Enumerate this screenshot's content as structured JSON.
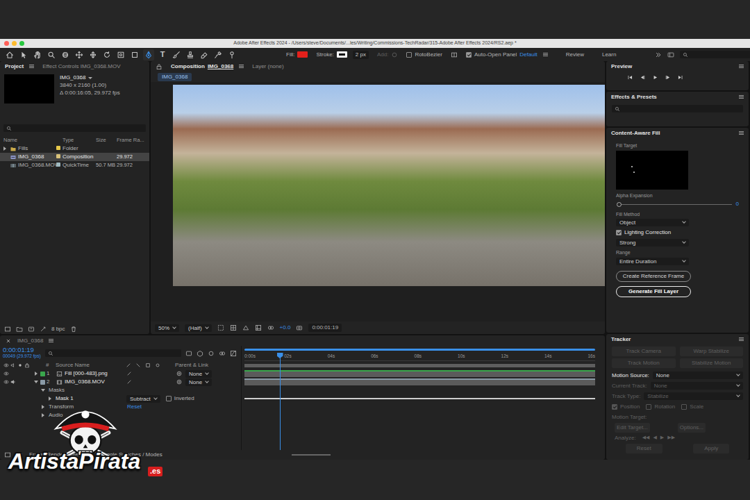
{
  "window": {
    "title": "Adobe After Effects 2024 - /Users/steve/Documents/...les/Writing/Commissions-TechRadar/315-Adobe After Effects 2024/RS2.aep *"
  },
  "toolbar": {
    "tools": [
      {
        "kind": "home",
        "selected": false
      },
      {
        "kind": "select",
        "selected": false
      },
      {
        "kind": "hand",
        "selected": false
      },
      {
        "kind": "zoom",
        "selected": false
      },
      {
        "kind": "orbit",
        "selected": false
      },
      {
        "kind": "pan",
        "selected": false
      },
      {
        "kind": "dolly",
        "selected": false
      },
      {
        "kind": "rotate",
        "selected": false
      },
      {
        "kind": "anchor",
        "selected": false
      },
      {
        "kind": "shape",
        "selected": false
      },
      {
        "kind": "pen",
        "selected": true
      },
      {
        "kind": "type",
        "glyph": "T",
        "selected": false
      },
      {
        "kind": "brush",
        "selected": false
      },
      {
        "kind": "stamp",
        "selected": false
      },
      {
        "kind": "eraser",
        "selected": false
      },
      {
        "kind": "roto",
        "selected": false
      },
      {
        "kind": "puppet",
        "selected": false
      }
    ],
    "fill": {
      "label": "Fill:",
      "color": "#e3201b"
    },
    "stroke": {
      "label": "Stroke:",
      "color": "#ffffff"
    },
    "stroke_width": "2 px",
    "add": {
      "label": "Add:",
      "disabled": true
    },
    "rotobezier": {
      "label": "RotoBezier",
      "checked": false
    },
    "auto_open": {
      "label": "Auto-Open Panel",
      "checked": true
    },
    "workspaces": [
      {
        "label": "Default",
        "selected": true
      },
      {
        "label": "Review",
        "selected": false
      },
      {
        "label": "Learn",
        "selected": false
      }
    ]
  },
  "project": {
    "tabs": [
      {
        "label": "Project",
        "selected": true
      },
      {
        "label": "Effect Controls IMG_0368.MOV",
        "selected": false
      }
    ],
    "item": {
      "name": "IMG_0368",
      "size": "3840 x 2160 (1.00)",
      "duration": "Δ 0:00:16:05, 29.972 fps"
    },
    "columns": [
      "Name",
      "Type",
      "Size",
      "Frame Ra..."
    ],
    "rows": [
      {
        "name": "Fills",
        "type": "Folder",
        "kind": "folder",
        "color": "#e6c84a",
        "selected": false
      },
      {
        "name": "IMG_0368",
        "type": "Composition",
        "fps": "29.972",
        "kind": "composition",
        "color": "#d9c27a",
        "selected": true
      },
      {
        "name": "IMG_0368.MOV",
        "type": "QuickTime",
        "size": "50.7 MB",
        "fps": "29.972",
        "kind": "footage",
        "color": "#9fb9c0",
        "selected": false
      }
    ],
    "bpc": "8 bpc"
  },
  "composition": {
    "tabs": [
      {
        "label": "Composition",
        "comp": "IMG_0368",
        "selected": true
      },
      {
        "label": "Layer (none)",
        "selected": false
      }
    ],
    "breadcrumb": "IMG_0368",
    "zoom": "50%",
    "resolution": "(Half)",
    "exposure": "+0.0",
    "time": "0:00:01:19"
  },
  "preview": {
    "title": "Preview"
  },
  "effects": {
    "title": "Effects & Presets"
  },
  "content_aware_fill": {
    "title": "Content-Aware Fill",
    "fill_target": "Fill Target",
    "alpha_expansion": {
      "label": "Alpha Expansion",
      "value": "0",
      "level": 0
    },
    "fill_method": {
      "label": "Fill Method",
      "value": "Object"
    },
    "lighting_correction": {
      "label": "Lighting Correction",
      "checked": true,
      "value": "Strong"
    },
    "range": {
      "label": "Range",
      "value": "Entire Duration"
    },
    "buttons": [
      {
        "label": "Create Reference Frame",
        "default": false
      },
      {
        "label": "Generate Fill Layer",
        "default": true
      }
    ]
  },
  "tracker": {
    "title": "Tracker",
    "buttons": [
      {
        "label": "Track Camera",
        "disabled": true
      },
      {
        "label": "Warp Stabilize",
        "disabled": true
      },
      {
        "label": "Track Motion",
        "disabled": true
      },
      {
        "label": "Stabilize Motion",
        "disabled": true
      }
    ],
    "motion_source": {
      "label": "Motion Source:",
      "value": "None",
      "disabled": false
    },
    "current_track": {
      "label": "Current Track:",
      "value": "None",
      "disabled": true
    },
    "track_type": {
      "label": "Track Type:",
      "value": "Stabilize",
      "disabled": true
    },
    "options": [
      {
        "label": "Position",
        "checked": true,
        "disabled": true
      },
      {
        "label": "Rotation",
        "checked": false,
        "disabled": true
      },
      {
        "label": "Scale",
        "checked": false,
        "disabled": true
      }
    ],
    "motion_target": {
      "label": "Motion Target:",
      "disabled": true
    },
    "edit_target": {
      "label": "Edit Target...",
      "disabled": true
    },
    "options_button": {
      "label": "Options...",
      "disabled": true
    },
    "analyze": {
      "label": "Analyze:",
      "buttons": [
        "◀◀",
        "◀",
        "▶",
        "▶▶"
      ],
      "disabled": true
    },
    "reset": {
      "label": "Reset",
      "disabled": true
    },
    "apply": {
      "label": "Apply",
      "disabled": true
    }
  },
  "timeline": {
    "tab": "IMG_0368",
    "time": "0:00:01:19",
    "frame": "00049 (29.972 fps)",
    "columns": {
      "index": "#",
      "source": "Source Name",
      "parent": "Parent & Link"
    },
    "layers": [
      {
        "index": "1",
        "name": "Fill [000-483].png",
        "parent": "None",
        "expanded": false,
        "audio": false,
        "color": "#3aa64c"
      },
      {
        "index": "2",
        "name": "IMG_0368.MOV",
        "parent": "None",
        "expanded": true,
        "audio": true,
        "color": "#8a9aa6"
      }
    ],
    "masks": {
      "label": "Masks",
      "expanded": true,
      "items": [
        {
          "name": "Mask 1",
          "expanded": false,
          "mode": "Subtract",
          "inverted_label": "Inverted",
          "inverted": false
        }
      ]
    },
    "transform": {
      "label": "Transform",
      "expanded": false,
      "reset": "Reset"
    },
    "audio": {
      "label": "Audio",
      "expanded": false
    },
    "ruler": [
      "0:00s",
      "02s",
      "04s",
      "06s",
      "08s",
      "10s",
      "12s",
      "14s",
      "16s"
    ],
    "playhead": 0.1,
    "footer": {
      "render_time": "Frame Render Time",
      "switches": "Toggle Switches / Modes"
    }
  },
  "watermark": {
    "text": "ArtistaPirata",
    "suffix": ".es"
  }
}
